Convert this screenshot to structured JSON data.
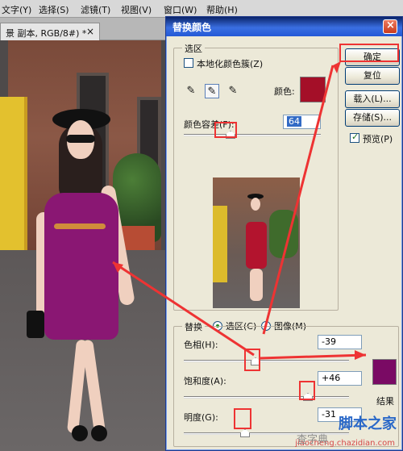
{
  "menubar": {
    "items": [
      "文字(Y)",
      "选择(S)",
      "滤镜(T)",
      "视图(V)",
      "窗口(W)",
      "帮助(H)"
    ]
  },
  "document": {
    "tab_title": "景 副本, RGB/8#) *",
    "close": "×"
  },
  "dialog": {
    "title": "替换颜色",
    "selection_group": "选区",
    "localized_color_clusters": "本地化颜色簇(Z)",
    "color_label": "颜色:",
    "fuzziness_label": "颜色容差(F):",
    "fuzziness_value": "64",
    "selection_color": "#a40f28",
    "view_selection": "选区(C)",
    "view_image": "图像(M)",
    "replace_group": "替换",
    "hue_label": "色相(H):",
    "hue_value": "-39",
    "saturation_label": "饱和度(A):",
    "saturation_value": "+46",
    "lightness_label": "明度(G):",
    "lightness_value": "-31",
    "result_label": "结果",
    "result_color": "#7a0a64"
  },
  "buttons": {
    "ok": "确定",
    "reset": "复位",
    "load": "载入(L)...",
    "save": "存储(S)...",
    "preview": "预览(P)"
  },
  "watermark": {
    "site1": "脚本之家",
    "site2": "jiaocheng.chazidian.com",
    "site3": "查字典"
  },
  "colors": {
    "accent": "#e33",
    "title_blue": "#2459d7"
  }
}
